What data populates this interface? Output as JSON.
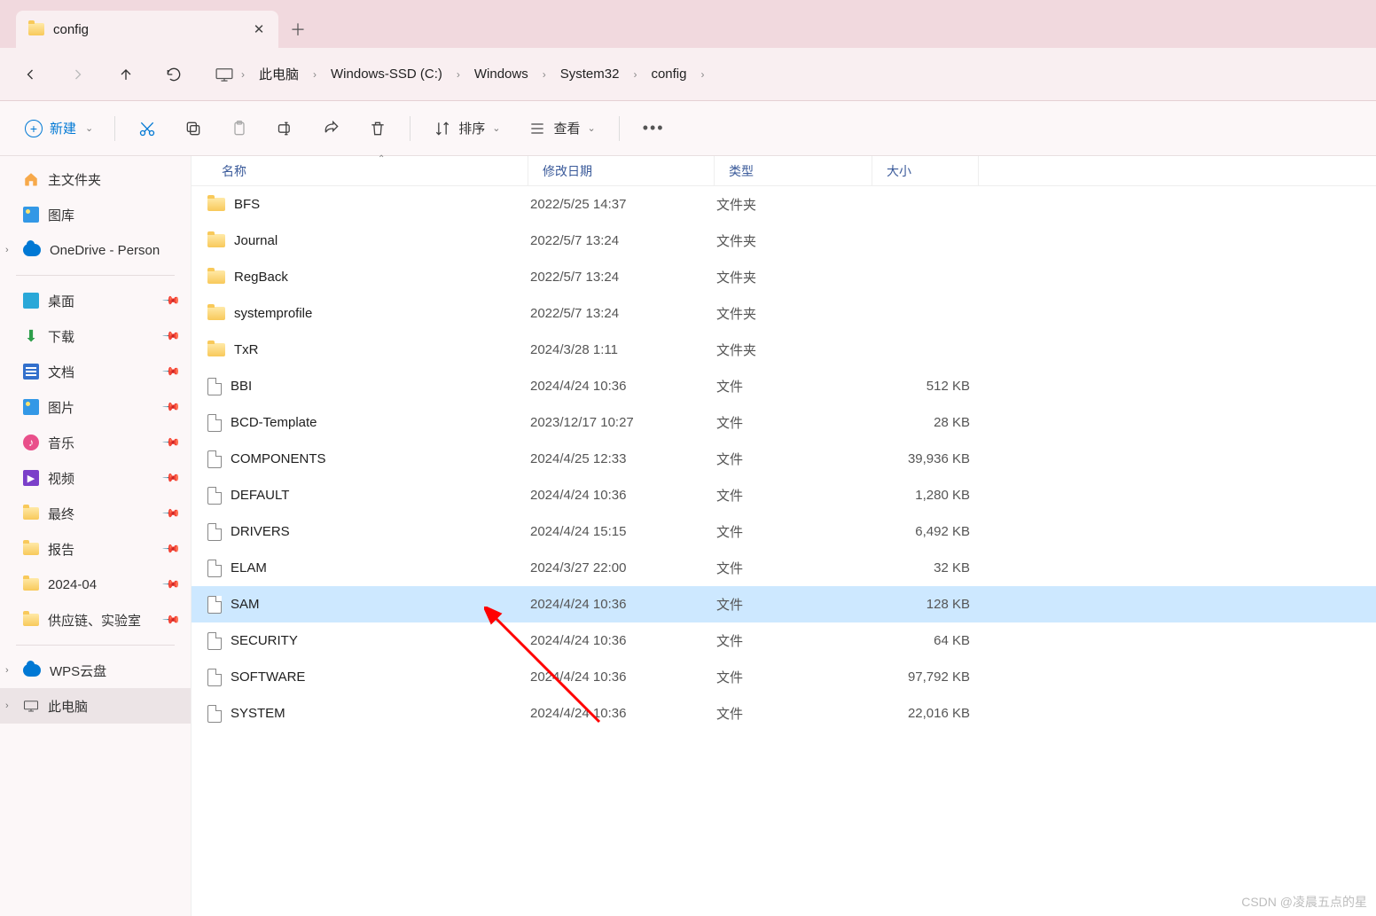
{
  "tab": {
    "title": "config"
  },
  "breadcrumb": {
    "root": "此电脑",
    "segs": [
      "Windows-SSD (C:)",
      "Windows",
      "System32",
      "config"
    ]
  },
  "toolbar": {
    "new_label": "新建",
    "sort_label": "排序",
    "view_label": "查看"
  },
  "sidebar": {
    "top": [
      {
        "label": "主文件夹",
        "icon": "home"
      },
      {
        "label": "图库",
        "icon": "gallery"
      },
      {
        "label": "OneDrive - Person",
        "icon": "cloud",
        "expandable": true
      }
    ],
    "quick": [
      {
        "label": "桌面",
        "icon": "desktop",
        "pinned": true
      },
      {
        "label": "下载",
        "icon": "download",
        "pinned": true
      },
      {
        "label": "文档",
        "icon": "doc",
        "pinned": true
      },
      {
        "label": "图片",
        "icon": "gallery",
        "pinned": true
      },
      {
        "label": "音乐",
        "icon": "music",
        "pinned": true
      },
      {
        "label": "视频",
        "icon": "video",
        "pinned": true
      },
      {
        "label": "最终",
        "icon": "folder",
        "pinned": true
      },
      {
        "label": "报告",
        "icon": "folder",
        "pinned": true
      },
      {
        "label": "2024-04",
        "icon": "folder",
        "pinned": true
      },
      {
        "label": "供应链、实验室",
        "icon": "folder",
        "pinned": true
      }
    ],
    "bottom": [
      {
        "label": "WPS云盘",
        "icon": "cloud",
        "expandable": true
      },
      {
        "label": "此电脑",
        "icon": "pc",
        "expandable": true,
        "selected": true
      }
    ]
  },
  "columns": {
    "name": "名称",
    "date": "修改日期",
    "type": "类型",
    "size": "大小"
  },
  "files": [
    {
      "name": "BFS",
      "date": "2022/5/25 14:37",
      "type": "文件夹",
      "size": "",
      "icon": "folder"
    },
    {
      "name": "Journal",
      "date": "2022/5/7 13:24",
      "type": "文件夹",
      "size": "",
      "icon": "folder"
    },
    {
      "name": "RegBack",
      "date": "2022/5/7 13:24",
      "type": "文件夹",
      "size": "",
      "icon": "folder"
    },
    {
      "name": "systemprofile",
      "date": "2022/5/7 13:24",
      "type": "文件夹",
      "size": "",
      "icon": "folder"
    },
    {
      "name": "TxR",
      "date": "2024/3/28 1:11",
      "type": "文件夹",
      "size": "",
      "icon": "folder"
    },
    {
      "name": "BBI",
      "date": "2024/4/24 10:36",
      "type": "文件",
      "size": "512 KB",
      "icon": "file"
    },
    {
      "name": "BCD-Template",
      "date": "2023/12/17 10:27",
      "type": "文件",
      "size": "28 KB",
      "icon": "file"
    },
    {
      "name": "COMPONENTS",
      "date": "2024/4/25 12:33",
      "type": "文件",
      "size": "39,936 KB",
      "icon": "file"
    },
    {
      "name": "DEFAULT",
      "date": "2024/4/24 10:36",
      "type": "文件",
      "size": "1,280 KB",
      "icon": "file"
    },
    {
      "name": "DRIVERS",
      "date": "2024/4/24 15:15",
      "type": "文件",
      "size": "6,492 KB",
      "icon": "file"
    },
    {
      "name": "ELAM",
      "date": "2024/3/27 22:00",
      "type": "文件",
      "size": "32 KB",
      "icon": "file"
    },
    {
      "name": "SAM",
      "date": "2024/4/24 10:36",
      "type": "文件",
      "size": "128 KB",
      "icon": "file",
      "selected": true
    },
    {
      "name": "SECURITY",
      "date": "2024/4/24 10:36",
      "type": "文件",
      "size": "64 KB",
      "icon": "file"
    },
    {
      "name": "SOFTWARE",
      "date": "2024/4/24 10:36",
      "type": "文件",
      "size": "97,792 KB",
      "icon": "file"
    },
    {
      "name": "SYSTEM",
      "date": "2024/4/24 10:36",
      "type": "文件",
      "size": "22,016 KB",
      "icon": "file"
    }
  ],
  "watermark": "CSDN @凌晨五点的星"
}
